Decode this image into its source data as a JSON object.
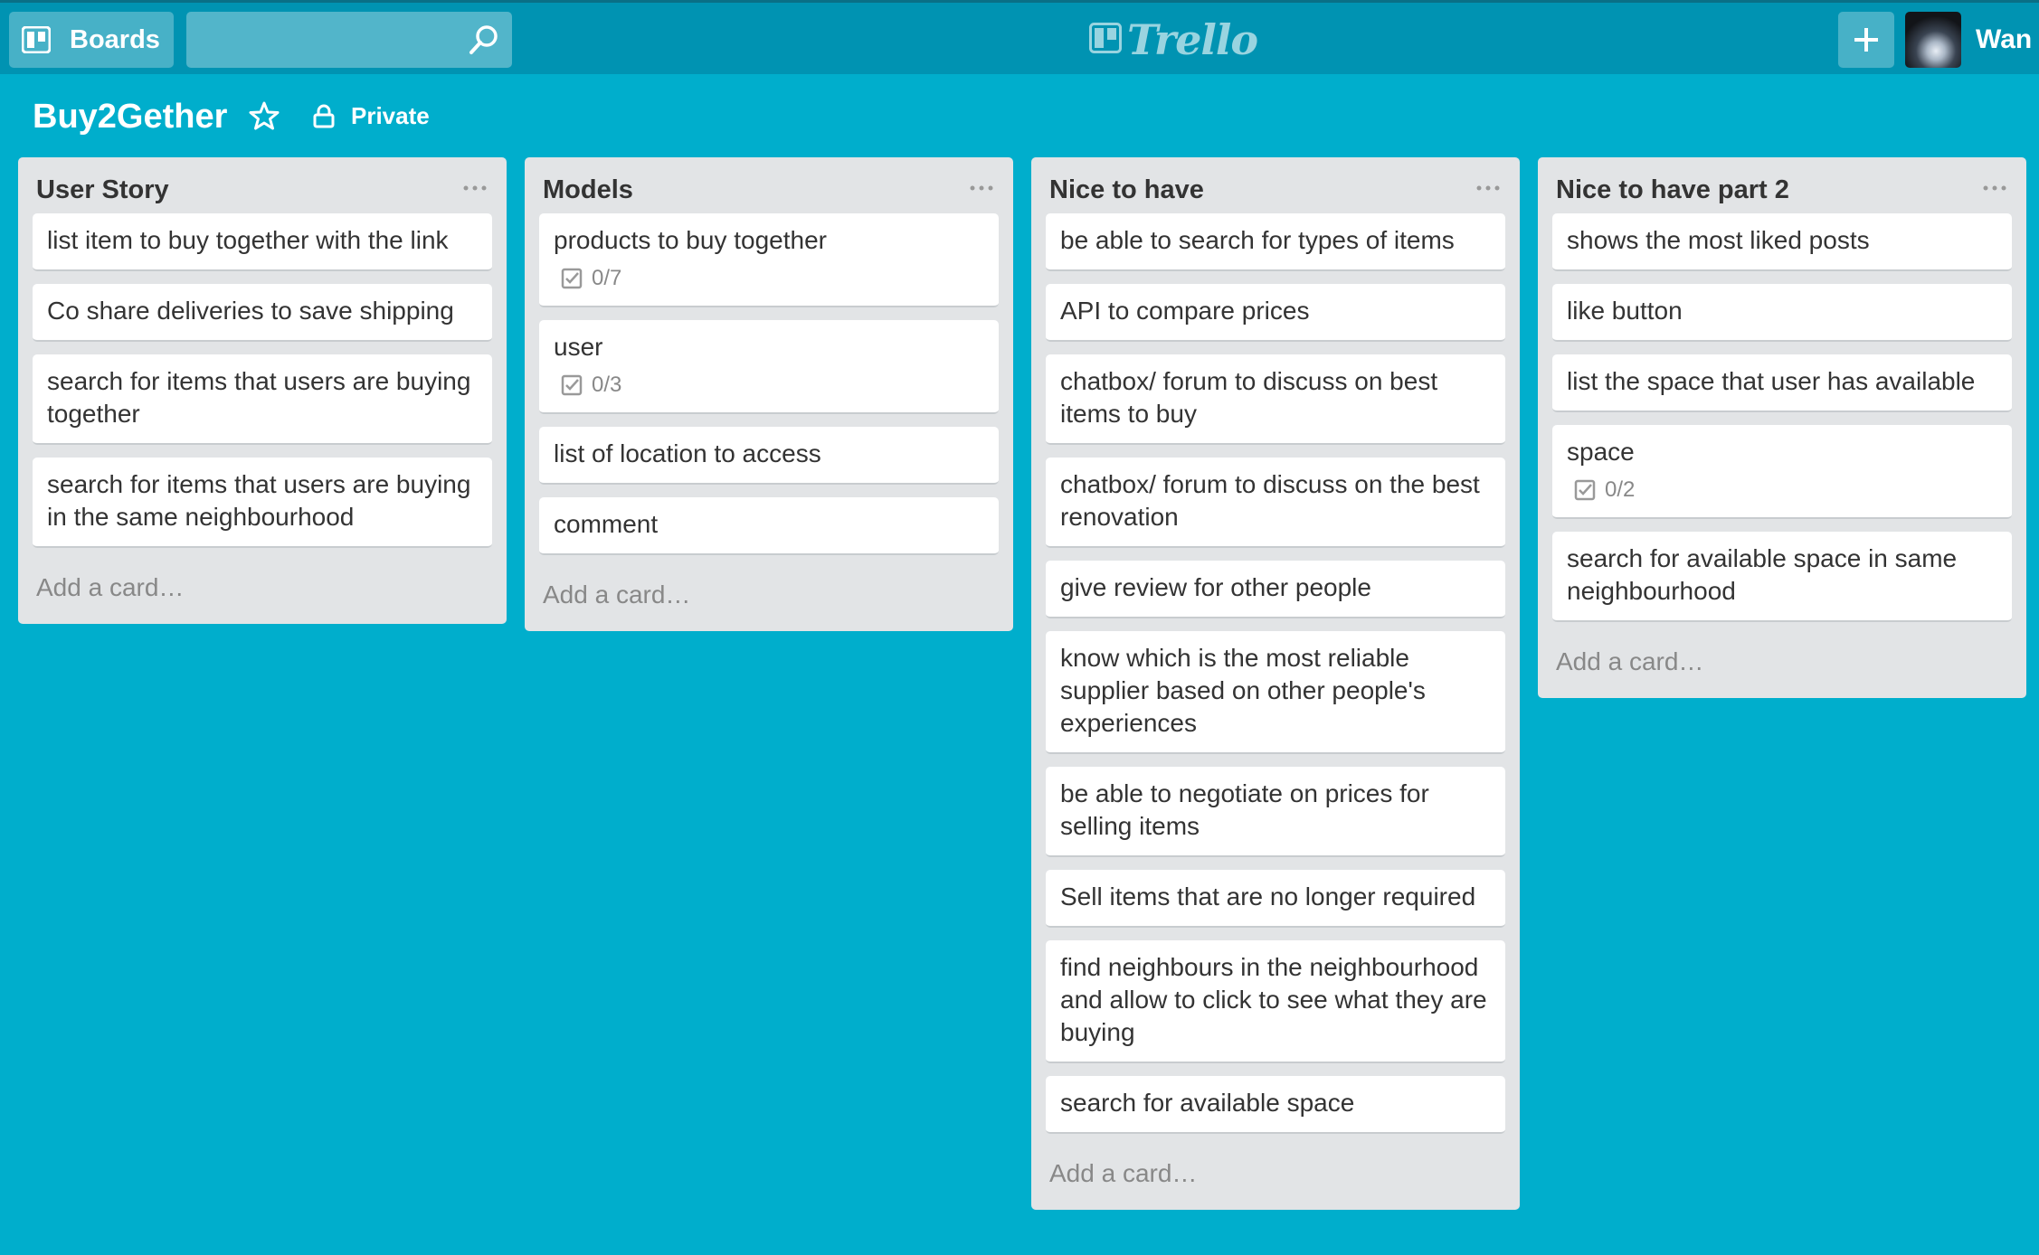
{
  "header": {
    "boards_label": "Boards",
    "search_placeholder": "",
    "logo_text": "Trello",
    "user_name": "Wan S"
  },
  "board": {
    "title": "Buy2Gether",
    "privacy_label": "Private"
  },
  "lists": [
    {
      "title": "User Story",
      "cards": [
        {
          "text": "list item to buy together with the link"
        },
        {
          "text": "Co share deliveries to save shipping"
        },
        {
          "text": "search for items that users are buying together"
        },
        {
          "text": "search for items that users are buying in the same neighbourhood"
        }
      ],
      "add_card": "Add a card…"
    },
    {
      "title": "Models",
      "cards": [
        {
          "text": "products to buy together",
          "checklist": "0/7"
        },
        {
          "text": "user",
          "checklist": "0/3"
        },
        {
          "text": "list of location to access"
        },
        {
          "text": "comment"
        }
      ],
      "add_card": "Add a card…"
    },
    {
      "title": "Nice to have",
      "cards": [
        {
          "text": "be able to search for types of items"
        },
        {
          "text": "API to compare prices"
        },
        {
          "text": "chatbox/ forum to discuss on best items to buy"
        },
        {
          "text": "chatbox/ forum to discuss on the best renovation"
        },
        {
          "text": "give review for other people"
        },
        {
          "text": "know which is the most reliable supplier based on other people's experiences"
        },
        {
          "text": "be able to negotiate on prices for selling items"
        },
        {
          "text": "Sell items that are no longer required"
        },
        {
          "text": "find neighbours in the neighbourhood and allow to click to see what they are buying"
        },
        {
          "text": "search for available space"
        }
      ],
      "add_card": "Add a card…"
    },
    {
      "title": "Nice to have part 2",
      "cards": [
        {
          "text": "shows the most liked posts"
        },
        {
          "text": "like button"
        },
        {
          "text": "list the space that user has available"
        },
        {
          "text": "space",
          "checklist": "0/2"
        },
        {
          "text": "search for available space in same neighbourhood"
        }
      ],
      "add_card": "Add a card…"
    }
  ],
  "icons": {
    "boards": "boards-icon",
    "search": "search-icon",
    "logo": "trello-logo-icon",
    "add": "plus-icon",
    "star": "star-icon",
    "privacy": "lock-icon",
    "list_menu": "more-icon",
    "checklist": "checklist-icon"
  },
  "colors": {
    "background": "#00aecc",
    "header": "#0093b2",
    "list_bg": "#e2e4e6",
    "card_bg": "#ffffff"
  }
}
